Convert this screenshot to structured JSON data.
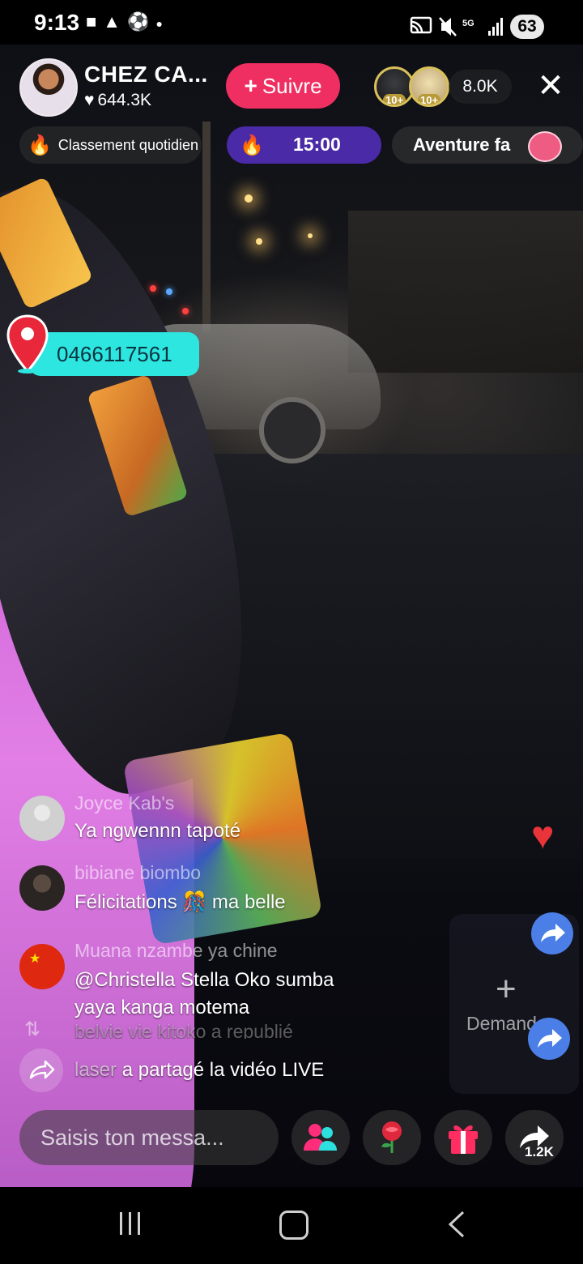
{
  "status_bar": {
    "time": "9:13",
    "icons_left": [
      "video-icon",
      "warning-icon",
      "soccer-ball-icon",
      "dot-icon"
    ],
    "icons_right": [
      "cast-icon",
      "mute-icon",
      "5g-icon",
      "signal-icon"
    ],
    "battery": "63"
  },
  "header": {
    "streamer_name": "CHEZ CA...",
    "likes": "644.3K",
    "follow_label": "Suivre",
    "viewer_badges": [
      "10+",
      "10+"
    ],
    "viewer_count": "8.0K"
  },
  "pills": {
    "ranking": "Classement quotidien",
    "timer": "15:00",
    "adventure": "Aventure fa"
  },
  "location": {
    "phone": "0466117561"
  },
  "comments": [
    {
      "user": "Joyce Kab's",
      "text": "Ya ngwennn tapoté"
    },
    {
      "user": "bibiane biombo",
      "text": "Félicitations 🎊 ma belle"
    },
    {
      "user": "Muana nzambe ya chine",
      "text_line1": "@Christella Stella Oko sumba",
      "text_line2": "yaya kanga motema"
    }
  ],
  "repost_notice": "belvie vie kitoko a republié",
  "share_notice": {
    "user": "laser",
    "text": "a partagé la vidéo LIVE"
  },
  "side_panel": {
    "request_label": "Demand"
  },
  "bottom_bar": {
    "message_placeholder": "Saisis ton messa...",
    "share_count": "1.2K"
  },
  "colors": {
    "follow": "#ef2f62",
    "timer_pill": "#4a2aa6",
    "location_tag": "#2de6e0",
    "accent_heart": "#e9343a"
  }
}
